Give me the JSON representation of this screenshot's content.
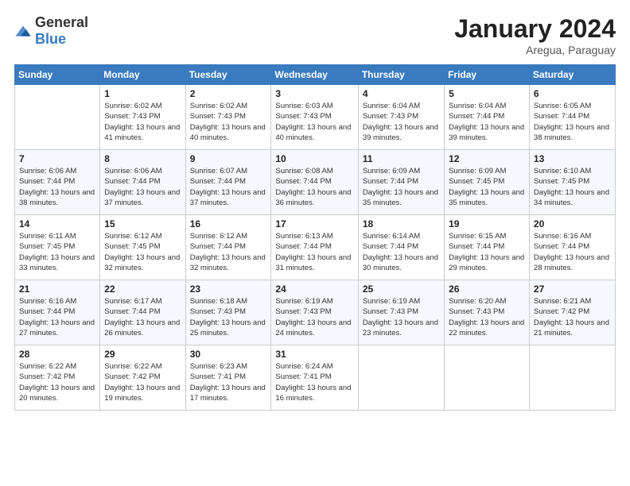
{
  "logo": {
    "general": "General",
    "blue": "Blue"
  },
  "title": "January 2024",
  "subtitle": "Aregua, Paraguay",
  "days_header": [
    "Sunday",
    "Monday",
    "Tuesday",
    "Wednesday",
    "Thursday",
    "Friday",
    "Saturday"
  ],
  "weeks": [
    [
      {
        "day": "",
        "sunrise": "",
        "sunset": "",
        "daylight": ""
      },
      {
        "day": "1",
        "sunrise": "Sunrise: 6:02 AM",
        "sunset": "Sunset: 7:43 PM",
        "daylight": "Daylight: 13 hours and 41 minutes."
      },
      {
        "day": "2",
        "sunrise": "Sunrise: 6:02 AM",
        "sunset": "Sunset: 7:43 PM",
        "daylight": "Daylight: 13 hours and 40 minutes."
      },
      {
        "day": "3",
        "sunrise": "Sunrise: 6:03 AM",
        "sunset": "Sunset: 7:43 PM",
        "daylight": "Daylight: 13 hours and 40 minutes."
      },
      {
        "day": "4",
        "sunrise": "Sunrise: 6:04 AM",
        "sunset": "Sunset: 7:43 PM",
        "daylight": "Daylight: 13 hours and 39 minutes."
      },
      {
        "day": "5",
        "sunrise": "Sunrise: 6:04 AM",
        "sunset": "Sunset: 7:44 PM",
        "daylight": "Daylight: 13 hours and 39 minutes."
      },
      {
        "day": "6",
        "sunrise": "Sunrise: 6:05 AM",
        "sunset": "Sunset: 7:44 PM",
        "daylight": "Daylight: 13 hours and 38 minutes."
      }
    ],
    [
      {
        "day": "7",
        "sunrise": "Sunrise: 6:06 AM",
        "sunset": "Sunset: 7:44 PM",
        "daylight": "Daylight: 13 hours and 38 minutes."
      },
      {
        "day": "8",
        "sunrise": "Sunrise: 6:06 AM",
        "sunset": "Sunset: 7:44 PM",
        "daylight": "Daylight: 13 hours and 37 minutes."
      },
      {
        "day": "9",
        "sunrise": "Sunrise: 6:07 AM",
        "sunset": "Sunset: 7:44 PM",
        "daylight": "Daylight: 13 hours and 37 minutes."
      },
      {
        "day": "10",
        "sunrise": "Sunrise: 6:08 AM",
        "sunset": "Sunset: 7:44 PM",
        "daylight": "Daylight: 13 hours and 36 minutes."
      },
      {
        "day": "11",
        "sunrise": "Sunrise: 6:09 AM",
        "sunset": "Sunset: 7:44 PM",
        "daylight": "Daylight: 13 hours and 35 minutes."
      },
      {
        "day": "12",
        "sunrise": "Sunrise: 6:09 AM",
        "sunset": "Sunset: 7:45 PM",
        "daylight": "Daylight: 13 hours and 35 minutes."
      },
      {
        "day": "13",
        "sunrise": "Sunrise: 6:10 AM",
        "sunset": "Sunset: 7:45 PM",
        "daylight": "Daylight: 13 hours and 34 minutes."
      }
    ],
    [
      {
        "day": "14",
        "sunrise": "Sunrise: 6:11 AM",
        "sunset": "Sunset: 7:45 PM",
        "daylight": "Daylight: 13 hours and 33 minutes."
      },
      {
        "day": "15",
        "sunrise": "Sunrise: 6:12 AM",
        "sunset": "Sunset: 7:45 PM",
        "daylight": "Daylight: 13 hours and 32 minutes."
      },
      {
        "day": "16",
        "sunrise": "Sunrise: 6:12 AM",
        "sunset": "Sunset: 7:44 PM",
        "daylight": "Daylight: 13 hours and 32 minutes."
      },
      {
        "day": "17",
        "sunrise": "Sunrise: 6:13 AM",
        "sunset": "Sunset: 7:44 PM",
        "daylight": "Daylight: 13 hours and 31 minutes."
      },
      {
        "day": "18",
        "sunrise": "Sunrise: 6:14 AM",
        "sunset": "Sunset: 7:44 PM",
        "daylight": "Daylight: 13 hours and 30 minutes."
      },
      {
        "day": "19",
        "sunrise": "Sunrise: 6:15 AM",
        "sunset": "Sunset: 7:44 PM",
        "daylight": "Daylight: 13 hours and 29 minutes."
      },
      {
        "day": "20",
        "sunrise": "Sunrise: 6:16 AM",
        "sunset": "Sunset: 7:44 PM",
        "daylight": "Daylight: 13 hours and 28 minutes."
      }
    ],
    [
      {
        "day": "21",
        "sunrise": "Sunrise: 6:16 AM",
        "sunset": "Sunset: 7:44 PM",
        "daylight": "Daylight: 13 hours and 27 minutes."
      },
      {
        "day": "22",
        "sunrise": "Sunrise: 6:17 AM",
        "sunset": "Sunset: 7:44 PM",
        "daylight": "Daylight: 13 hours and 26 minutes."
      },
      {
        "day": "23",
        "sunrise": "Sunrise: 6:18 AM",
        "sunset": "Sunset: 7:43 PM",
        "daylight": "Daylight: 13 hours and 25 minutes."
      },
      {
        "day": "24",
        "sunrise": "Sunrise: 6:19 AM",
        "sunset": "Sunset: 7:43 PM",
        "daylight": "Daylight: 13 hours and 24 minutes."
      },
      {
        "day": "25",
        "sunrise": "Sunrise: 6:19 AM",
        "sunset": "Sunset: 7:43 PM",
        "daylight": "Daylight: 13 hours and 23 minutes."
      },
      {
        "day": "26",
        "sunrise": "Sunrise: 6:20 AM",
        "sunset": "Sunset: 7:43 PM",
        "daylight": "Daylight: 13 hours and 22 minutes."
      },
      {
        "day": "27",
        "sunrise": "Sunrise: 6:21 AM",
        "sunset": "Sunset: 7:42 PM",
        "daylight": "Daylight: 13 hours and 21 minutes."
      }
    ],
    [
      {
        "day": "28",
        "sunrise": "Sunrise: 6:22 AM",
        "sunset": "Sunset: 7:42 PM",
        "daylight": "Daylight: 13 hours and 20 minutes."
      },
      {
        "day": "29",
        "sunrise": "Sunrise: 6:22 AM",
        "sunset": "Sunset: 7:42 PM",
        "daylight": "Daylight: 13 hours and 19 minutes."
      },
      {
        "day": "30",
        "sunrise": "Sunrise: 6:23 AM",
        "sunset": "Sunset: 7:41 PM",
        "daylight": "Daylight: 13 hours and 17 minutes."
      },
      {
        "day": "31",
        "sunrise": "Sunrise: 6:24 AM",
        "sunset": "Sunset: 7:41 PM",
        "daylight": "Daylight: 13 hours and 16 minutes."
      },
      {
        "day": "",
        "sunrise": "",
        "sunset": "",
        "daylight": ""
      },
      {
        "day": "",
        "sunrise": "",
        "sunset": "",
        "daylight": ""
      },
      {
        "day": "",
        "sunrise": "",
        "sunset": "",
        "daylight": ""
      }
    ]
  ]
}
